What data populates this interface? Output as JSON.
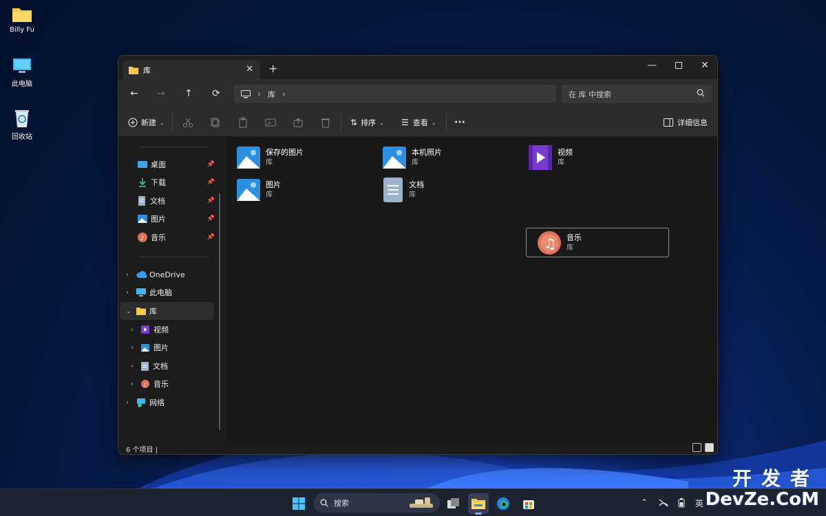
{
  "desktop": {
    "icons": [
      {
        "label": "Billy Fu",
        "icon": "user-folder-icon"
      },
      {
        "label": "此电脑",
        "icon": "computer-icon"
      },
      {
        "label": "回收站",
        "icon": "recycle-bin-icon"
      }
    ]
  },
  "window": {
    "tab_title": "库",
    "address": {
      "segment": "库"
    },
    "search_placeholder": "在 库 中搜索",
    "toolbar": {
      "new_label": "新建",
      "sort_label": "排序",
      "view_label": "查看",
      "more_label": "···",
      "details_label": "详细信息"
    },
    "sidebar": {
      "quick_access": [
        {
          "label": "桌面",
          "icon": "desktop-icon"
        },
        {
          "label": "下载",
          "icon": "download-icon"
        },
        {
          "label": "文档",
          "icon": "document-icon"
        },
        {
          "label": "图片",
          "icon": "picture-icon"
        },
        {
          "label": "音乐",
          "icon": "music-icon"
        }
      ],
      "tree": [
        {
          "label": "OneDrive",
          "icon": "cloud-icon"
        },
        {
          "label": "此电脑",
          "icon": "computer-icon"
        },
        {
          "label": "库",
          "icon": "folder-icon",
          "expanded": true,
          "selected": true
        },
        {
          "label": "视频",
          "icon": "video-icon"
        },
        {
          "label": "图片",
          "icon": "picture-icon"
        },
        {
          "label": "文档",
          "icon": "document-icon"
        },
        {
          "label": "音乐",
          "icon": "music-icon"
        },
        {
          "label": "网络",
          "icon": "network-icon"
        }
      ]
    },
    "libraries": [
      {
        "name": "保存的图片",
        "sub": "库",
        "icon": "picture-icon"
      },
      {
        "name": "本机照片",
        "sub": "库",
        "icon": "picture-icon"
      },
      {
        "name": "视频",
        "sub": "库",
        "icon": "video-icon"
      },
      {
        "name": "图片",
        "sub": "库",
        "icon": "picture-icon"
      },
      {
        "name": "文档",
        "sub": "库",
        "icon": "document-icon"
      },
      {
        "name": "音乐",
        "sub": "库",
        "icon": "music-icon"
      }
    ],
    "status": "6 个项目  |"
  },
  "taskbar": {
    "search_label": "搜索",
    "ime": "英"
  },
  "watermark": {
    "cn": "开发者",
    "en": "DevZe.CoM"
  }
}
